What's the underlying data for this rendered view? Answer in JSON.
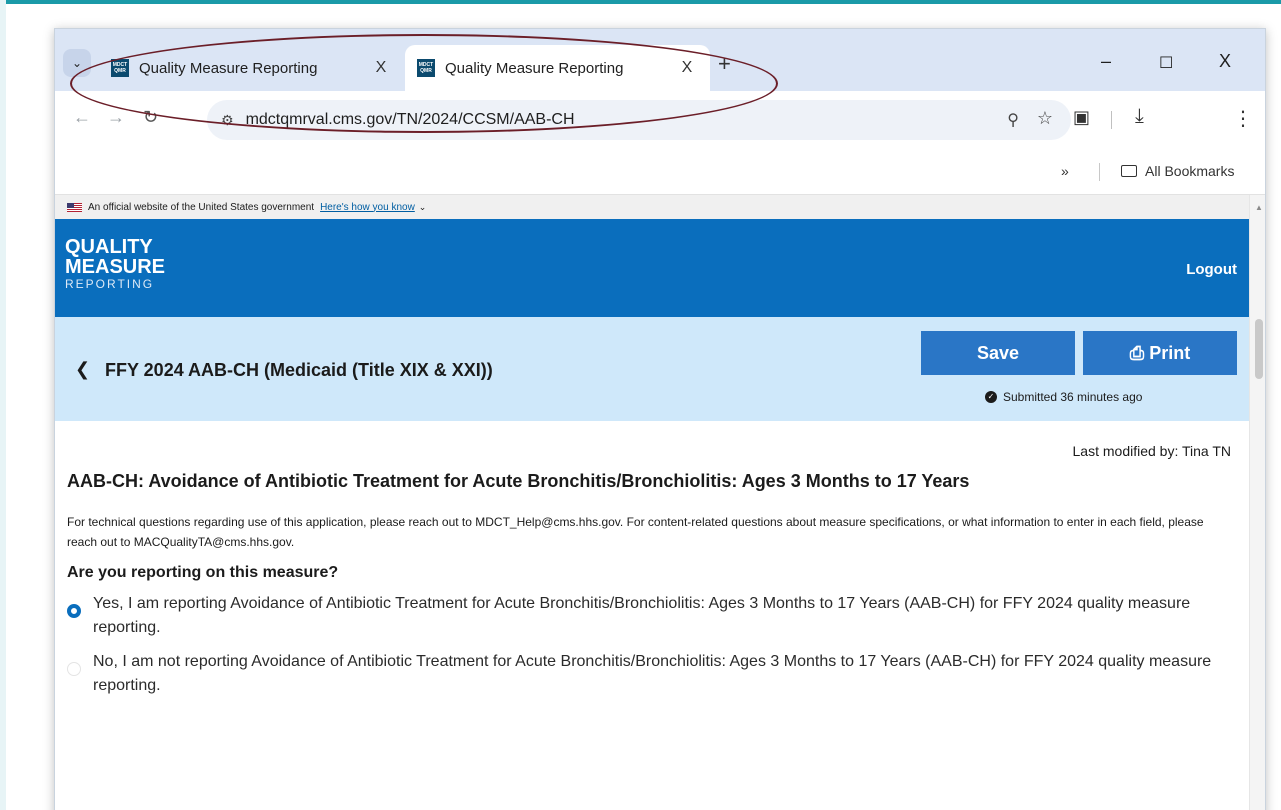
{
  "browser": {
    "tabs": [
      {
        "title": "Quality Measure Reporting",
        "close": "X"
      },
      {
        "title": "Quality Measure Reporting",
        "close": "X"
      }
    ],
    "favicon_text": "MDCT QMR",
    "new_tab": "+",
    "window_controls": {
      "minimize": "–",
      "maximize": "☐",
      "close": "X"
    },
    "url": "mdctqmrval.cms.gov/TN/2024/CCSM/AAB-CH",
    "bookmarks": {
      "more": "»",
      "all_bookmarks": "All Bookmarks"
    }
  },
  "gov_banner": {
    "text": "An official website of the United States government",
    "link": "Here's how you know"
  },
  "header": {
    "logo_line1": "QUALITY",
    "logo_line2": "MEASURE",
    "logo_line3": "REPORTING",
    "logout": "Logout"
  },
  "subheader": {
    "title": "FFY 2024  AAB-CH (Medicaid (Title XIX & XXI))",
    "save": "Save",
    "print": "Print",
    "submitted": "Submitted 36 minutes ago"
  },
  "content": {
    "last_modified": "Last modified by: Tina TN",
    "measure_title": "AAB-CH: Avoidance of Antibiotic Treatment for Acute Bronchitis/Bronchiolitis: Ages 3 Months to 17 Years",
    "help_text": "For technical questions regarding use of this application, please reach out to MDCT_Help@cms.hhs.gov. For content-related questions about measure specifications, or what information to enter in each field, please reach out to MACQualityTA@cms.hhs.gov.",
    "question": "Are you reporting on this measure?",
    "options": [
      {
        "label": "Yes, I am reporting Avoidance of Antibiotic Treatment for Acute Bronchitis/Bronchiolitis: Ages 3 Months to 17 Years (AAB-CH) for FFY 2024 quality measure reporting.",
        "selected": true
      },
      {
        "label": "No, I am not reporting Avoidance of Antibiotic Treatment for Acute Bronchitis/Bronchiolitis: Ages 3 Months to 17 Years (AAB-CH) for FFY 2024 quality measure reporting.",
        "selected": false
      }
    ]
  },
  "colors": {
    "header_blue": "#0a6ebd",
    "subheader_blue": "#cfe8fa",
    "button_blue": "#2a76c6",
    "annotation": "#6b1e28",
    "tabstrip": "#dbe5f5"
  },
  "icons": [
    "tab-search-icon",
    "favicon-icon",
    "close-icon",
    "back-icon",
    "forward-icon",
    "reload-icon",
    "site-info-icon",
    "zoom-icon",
    "star-icon",
    "extensions-icon",
    "download-icon",
    "menu-icon",
    "folder-icon",
    "flag-icon",
    "chevron-left-icon",
    "print-icon",
    "check-circle-icon"
  ]
}
